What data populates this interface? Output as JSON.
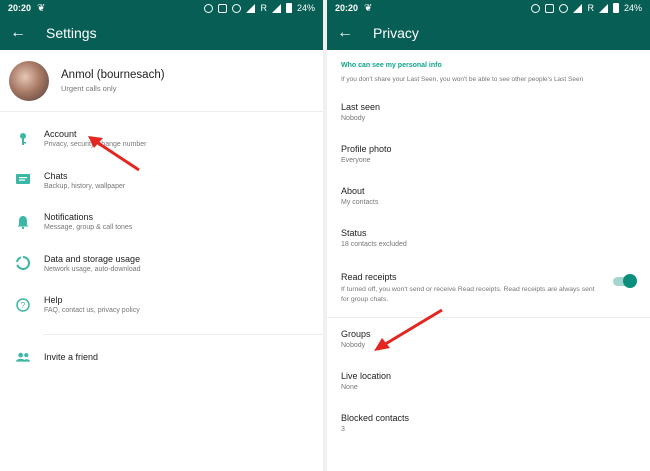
{
  "colors": {
    "primary": "#075e54",
    "accent": "#11a58a",
    "arrow": "#e3261f"
  },
  "status_bar": {
    "time": "20:20",
    "network": "R",
    "battery": "24%"
  },
  "settings": {
    "title": "Settings",
    "profile": {
      "name": "Anmol (bournesach)",
      "status": "Urgent calls only"
    },
    "items": [
      {
        "label": "Account",
        "sub": "Privacy, security, change number",
        "icon": "key-icon"
      },
      {
        "label": "Chats",
        "sub": "Backup, history, wallpaper",
        "icon": "chat-icon"
      },
      {
        "label": "Notifications",
        "sub": "Message, group & call tones",
        "icon": "bell-icon"
      },
      {
        "label": "Data and storage usage",
        "sub": "Network usage, auto-download",
        "icon": "data-usage-icon"
      },
      {
        "label": "Help",
        "sub": "FAQ, contact us, privacy policy",
        "icon": "help-icon"
      }
    ],
    "invite": {
      "label": "Invite a friend",
      "icon": "people-icon"
    }
  },
  "privacy": {
    "title": "Privacy",
    "section_title": "Who can see my personal info",
    "section_desc": "If you don't share your Last Seen, you won't be able to see other people's Last Seen",
    "items": [
      {
        "label": "Last seen",
        "value": "Nobody"
      },
      {
        "label": "Profile photo",
        "value": "Everyone"
      },
      {
        "label": "About",
        "value": "My contacts"
      },
      {
        "label": "Status",
        "value": "18 contacts excluded"
      }
    ],
    "read_receipts": {
      "label": "Read receipts",
      "desc": "If turned off, you won't send or receive Read receipts. Read receipts are always sent for group chats.",
      "enabled": true
    },
    "items2": [
      {
        "label": "Groups",
        "value": "Nobody"
      },
      {
        "label": "Live location",
        "value": "None"
      },
      {
        "label": "Blocked contacts",
        "value": "3"
      }
    ]
  }
}
